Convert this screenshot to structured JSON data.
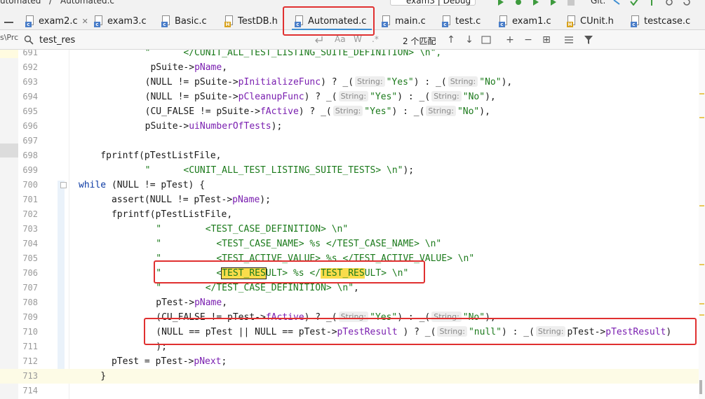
{
  "top": {
    "breadcrumb": [
      "utomated",
      "/",
      "Automated.c"
    ],
    "run_config": "exam3 | Debug",
    "vcs_label": "Git:"
  },
  "tabs": [
    {
      "label": "exam2.c",
      "type": "c",
      "active": false
    },
    {
      "label": "exam3.c",
      "type": "c",
      "active": false
    },
    {
      "label": "Basic.c",
      "type": "c",
      "active": false
    },
    {
      "label": "TestDB.h",
      "type": "h",
      "active": false
    },
    {
      "label": "Automated.c",
      "type": "c",
      "active": true
    },
    {
      "label": "main.c",
      "type": "c",
      "active": false
    },
    {
      "label": "test.c",
      "type": "c",
      "active": false
    },
    {
      "label": "exam1.c",
      "type": "c",
      "active": false
    },
    {
      "label": "CUnit.h",
      "type": "h",
      "active": false
    },
    {
      "label": "testcase.c",
      "type": "c",
      "active": false
    }
  ],
  "left_pane": {
    "fragment": "s\\Prc"
  },
  "find": {
    "query": "test_res",
    "options": [
      "Aa",
      "W",
      ".*"
    ],
    "count": "2 个匹配"
  },
  "hints": {
    "string": "String:"
  },
  "code": {
    "l691": {
      "ln": "691",
      "a": "        \"      </CUNIT_ALL_TEST_LISTING_SUITE_DEFINITION> \\n\","
    },
    "l692": {
      "ln": "692",
      "a": "         pSuite->",
      "b": "pName",
      "c": ","
    },
    "l693": {
      "ln": "693",
      "a": "        (NULL != pSuite->",
      "b": "pInitializeFunc",
      "c": ") ? _(",
      "s1": "\"Yes\"",
      "d": ") : _(",
      "s2": "\"No\"",
      "e": "),"
    },
    "l694": {
      "ln": "694",
      "a": "        (NULL != pSuite->",
      "b": "pCleanupFunc",
      "c": ") ? _(",
      "s1": "\"Yes\"",
      "d": ") : _(",
      "s2": "\"No\"",
      "e": "),"
    },
    "l695": {
      "ln": "695",
      "a": "        (CU_FALSE != pSuite->",
      "b": "fActive",
      "c": ") ? _(",
      "s1": "\"Yes\"",
      "d": ") : _(",
      "s2": "\"No\"",
      "e": "),"
    },
    "l696": {
      "ln": "696",
      "a": "        pSuite->",
      "b": "uiNumberOfTests",
      "c": ");"
    },
    "l697": {
      "ln": "697"
    },
    "l698": {
      "ln": "698",
      "a": "    fprintf(pTestListFile,"
    },
    "l699": {
      "ln": "699",
      "a": "        \"      <CUNIT_ALL_TEST_LISTING_SUITE_TESTS> \\n\"",
      "b": ");"
    },
    "l700": {
      "ln": "700",
      "kw": "while",
      "a": " (NULL != pTest) {"
    },
    "l701": {
      "ln": "701",
      "a": "      assert(NULL != pTest->",
      "b": "pName",
      "c": ");"
    },
    "l702": {
      "ln": "702",
      "a": "      fprintf(pTestListFile,"
    },
    "l703": {
      "ln": "703",
      "a": "          \"        <TEST_CASE_DEFINITION> \\n\""
    },
    "l704": {
      "ln": "704",
      "a": "          \"          <TEST_CASE_NAME> %s </TEST_CASE_NAME> \\n\""
    },
    "l705": {
      "ln": "705",
      "a": "          \"          <TEST_ACTIVE_VALUE> %s </TEST_ACTIVE_VALUE> \\n\""
    },
    "l706": {
      "ln": "706",
      "a": "          \"          <",
      "m1": "TEST_RES",
      "b": "ULT> %s </",
      "m2": "TEST_RES",
      "c": "ULT> \\n\""
    },
    "l707": {
      "ln": "707",
      "a": "          \"        </TEST_CASE_DEFINITION> \\n\"",
      "b": ","
    },
    "l708": {
      "ln": "708",
      "a": "          pTest->",
      "b": "pName",
      "c": ","
    },
    "l709": {
      "ln": "709",
      "a": "          (CU_FALSE != pTest->",
      "b": "fActive",
      "c": ") ? _(",
      "s1": "\"Yes\"",
      "d": ") : _(",
      "s2": "\"No\"",
      "e": "),"
    },
    "l710": {
      "ln": "710",
      "a": "          (NULL == pTest || NULL == pTest->",
      "b": "pTestResult",
      "c": " ) ? _(",
      "s1": "\"null\"",
      "d": ") : _(",
      "e": "pTest->",
      "f": "pTestResult",
      "g": ")"
    },
    "l711": {
      "ln": "711",
      "a": "          );"
    },
    "l712": {
      "ln": "712",
      "a": "      pTest = pTest->",
      "b": "pNext",
      "c": ";"
    },
    "l713": {
      "ln": "713",
      "a": "    }"
    },
    "l714": {
      "ln": "714"
    }
  },
  "colors": {
    "string": "#1b7a1b",
    "keyword": "#0b3aa4",
    "field": "#7a1fb0",
    "match": "#f9dc4b",
    "annotation_box": "#e03030",
    "active_tab": "#3f8fd2"
  }
}
